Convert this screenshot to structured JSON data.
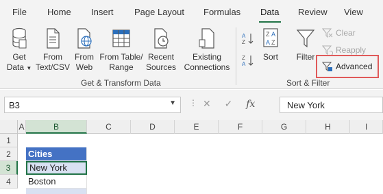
{
  "ribbon_tabs": [
    "File",
    "Home",
    "Insert",
    "Page Layout",
    "Formulas",
    "Data",
    "Review",
    "View"
  ],
  "active_tab": "Data",
  "get_transform": {
    "get_data": {
      "line1": "Get",
      "line2": "Data"
    },
    "from_text_csv": {
      "line1": "From",
      "line2": "Text/CSV"
    },
    "from_web": {
      "line1": "From",
      "line2": "Web"
    },
    "from_table_range": {
      "line1": "From Table/",
      "line2": "Range"
    },
    "recent_sources": {
      "line1": "Recent",
      "line2": "Sources"
    },
    "existing_connections": {
      "line1": "Existing",
      "line2": "Connections"
    },
    "group_label": "Get & Transform Data"
  },
  "sort_filter": {
    "sort_label": "Sort",
    "filter_label": "Filter",
    "clear_label": "Clear",
    "reapply_label": "Reapply",
    "advanced_label": "Advanced",
    "group_label": "Sort & Filter"
  },
  "formula_bar": {
    "name_box": "B3",
    "value": "New York",
    "fx": "fx"
  },
  "columns": [
    "A",
    "B",
    "C",
    "D",
    "E",
    "F",
    "G",
    "H",
    "I"
  ],
  "rows": [
    "1",
    "2",
    "3",
    "4"
  ],
  "cells": {
    "b2": "Cities",
    "b3": "New York",
    "b4": "Boston"
  },
  "colors": {
    "accent": "#217346",
    "table_header": "#4472c4",
    "table_band": "#d9e1f2",
    "highlight_box": "#e05a5a"
  }
}
